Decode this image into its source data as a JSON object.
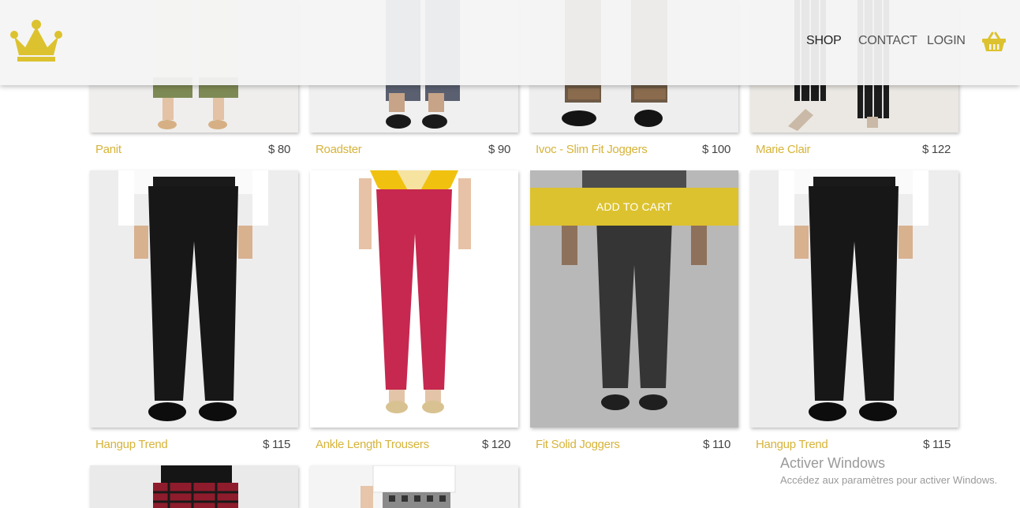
{
  "header": {
    "logo_icon": "crown-icon",
    "nav": [
      {
        "label": "SHOP"
      },
      {
        "label": "CONTACT"
      },
      {
        "label": "LOGIN"
      }
    ],
    "cart_icon": "basket-icon",
    "accent_color": "#dcc22e"
  },
  "products": [
    {
      "name": "Panit",
      "price": "$ 80"
    },
    {
      "name": "Roadster",
      "price": "$ 90"
    },
    {
      "name": "Ivoc - Slim Fit Joggers",
      "price": "$ 100"
    },
    {
      "name": "Marie Clair",
      "price": "$ 122"
    },
    {
      "name": "Hangup Trend",
      "price": "$ 115"
    },
    {
      "name": "Ankle Length Trousers",
      "price": "$ 120"
    },
    {
      "name": "Fit Solid Joggers",
      "price": "$ 110",
      "hover_action": "ADD TO CART"
    },
    {
      "name": "Hangup Trend",
      "price": "$ 115"
    }
  ],
  "watermark": {
    "title": "Activer Windows",
    "subtitle": "Accédez aux paramètres pour activer Windows."
  }
}
